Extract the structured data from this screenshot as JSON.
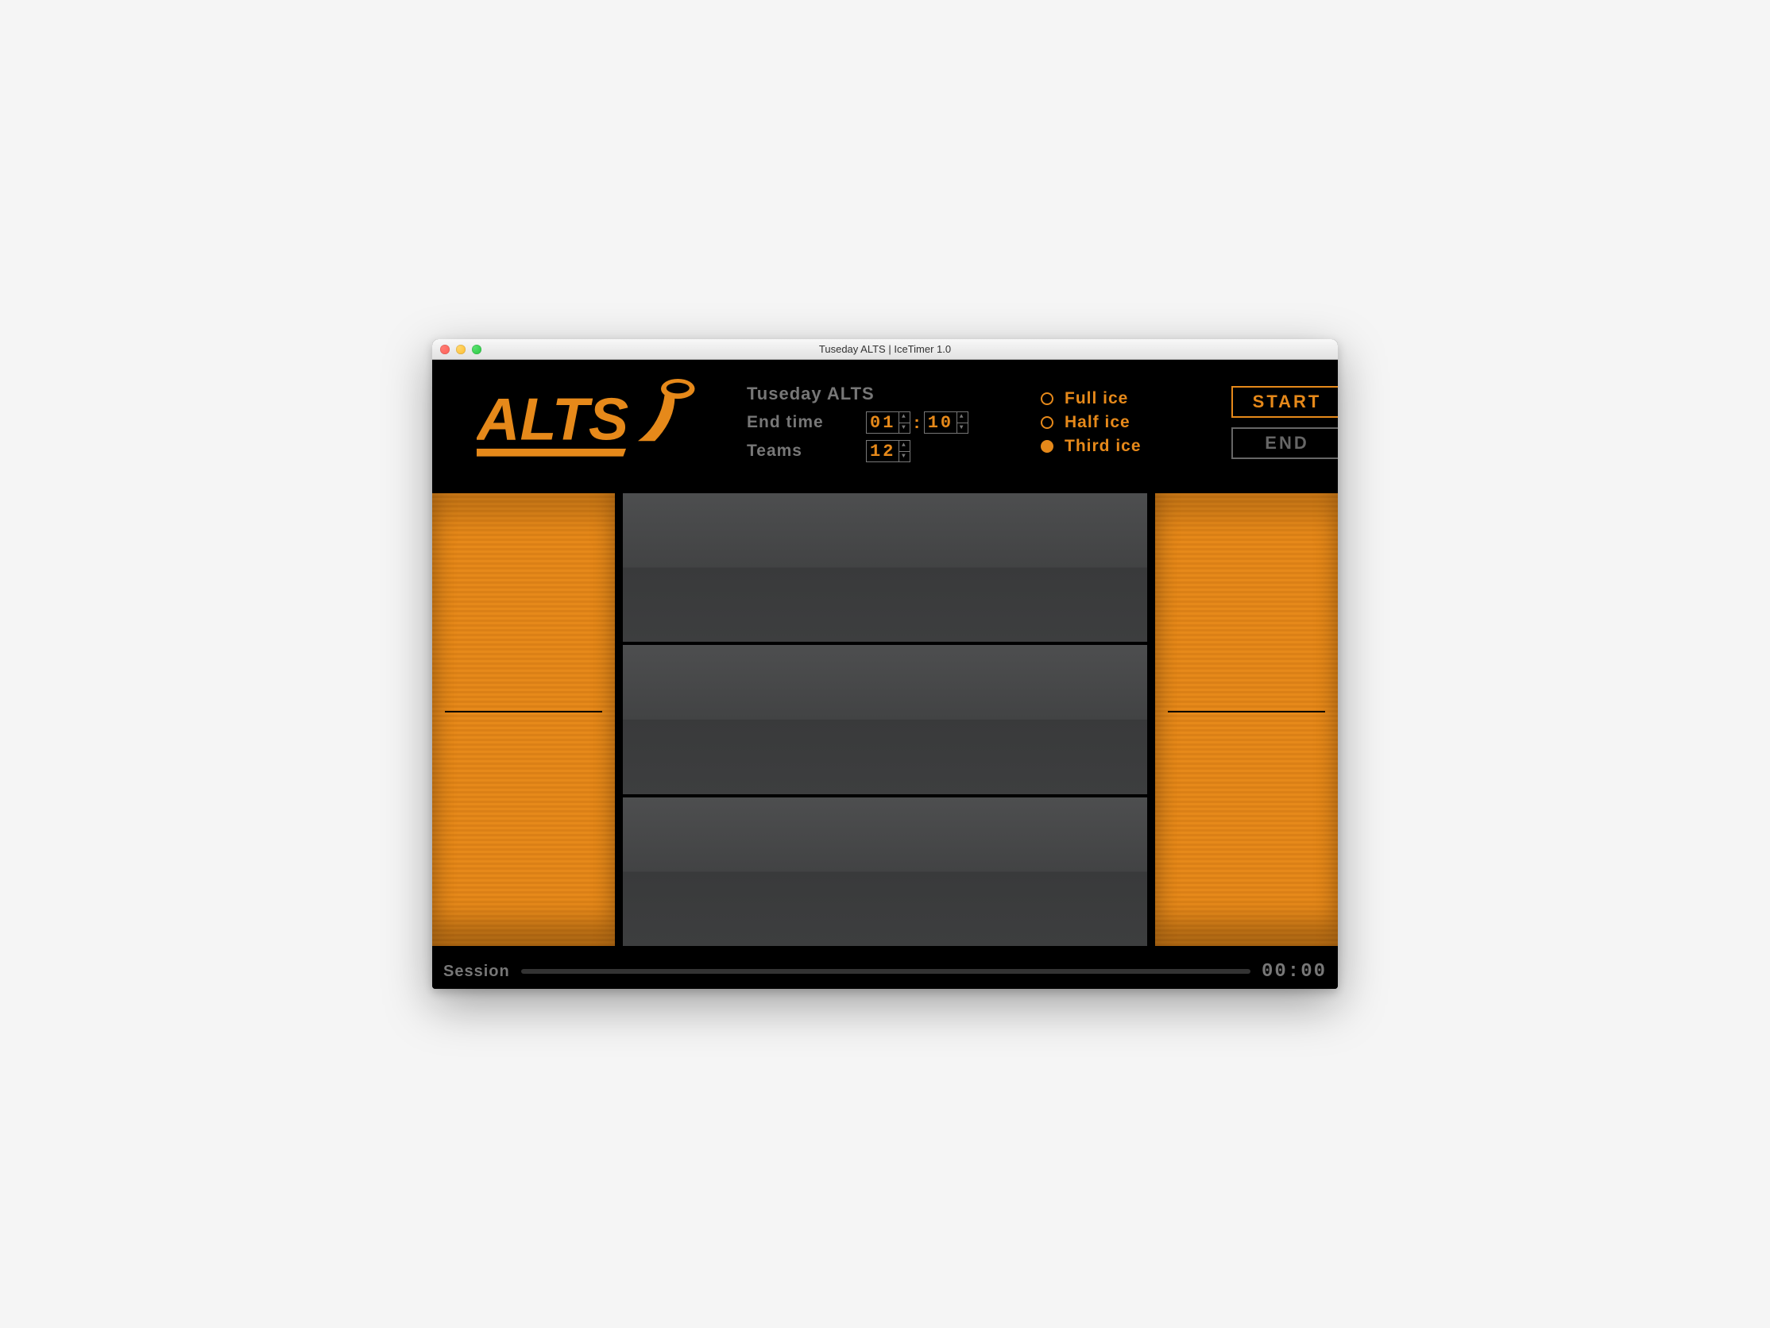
{
  "window": {
    "title": "Tuseday ALTS | IceTimer 1.0"
  },
  "logo": {
    "text": "ALTS"
  },
  "settings": {
    "title": "Tuseday ALTS",
    "end_time_label": "End time",
    "end_time_hours": "01",
    "end_time_minutes": "10",
    "teams_label": "Teams",
    "teams_value": "12"
  },
  "ice_options": {
    "options": [
      {
        "label": "Full ice",
        "selected": false
      },
      {
        "label": "Half ice",
        "selected": false
      },
      {
        "label": "Third ice",
        "selected": true
      }
    ]
  },
  "actions": {
    "start_label": "START",
    "end_label": "END"
  },
  "footer": {
    "session_label": "Session",
    "time": "00:00"
  },
  "colors": {
    "accent": "#e6891a"
  }
}
